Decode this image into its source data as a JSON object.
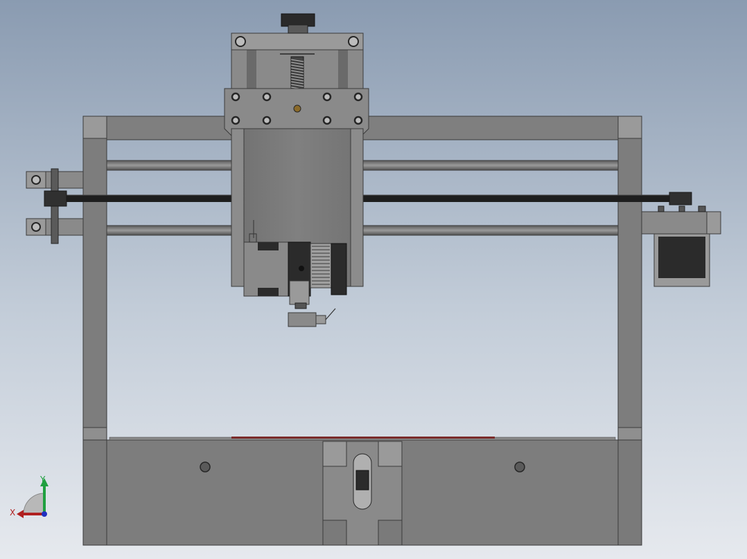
{
  "viewport": {
    "background_top": "#8a9bb1",
    "background_bottom": "#e6e9ee"
  },
  "colors": {
    "frame": "#7d7d7d",
    "frame_dark": "#6c6c6c",
    "frame_light": "#9a9a9a",
    "edge": "#3a3a3a",
    "motor_dark": "#2b2b2b",
    "bed_strip": "#7a2a2a",
    "belt": "#1e1e1e",
    "bolt": "#262626",
    "brass": "#8a6a2a"
  },
  "triad": {
    "x_label": "X",
    "y_label": "Y",
    "x_color": "#b02020",
    "y_color": "#20a040",
    "z_color": "#2030c0"
  }
}
